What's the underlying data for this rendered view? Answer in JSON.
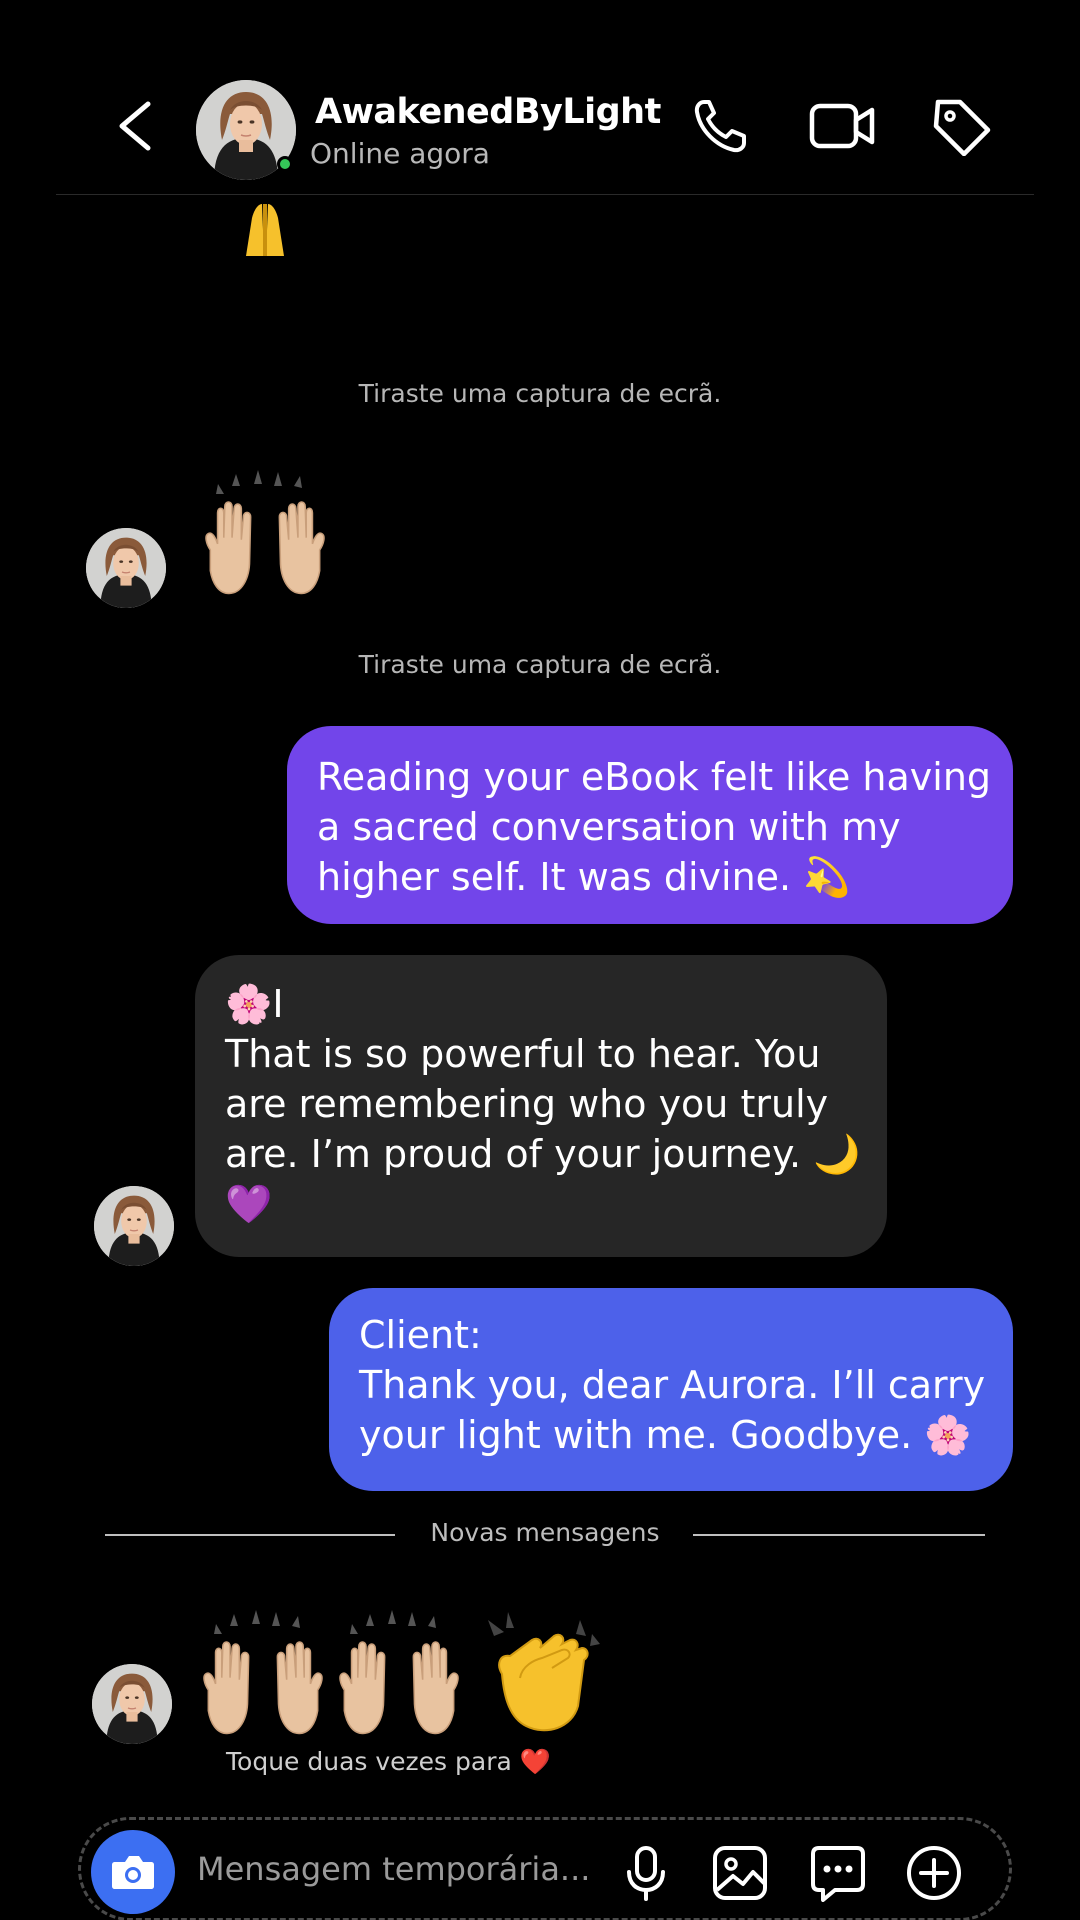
{
  "header": {
    "contact_name": "AwakenedByLight",
    "status": "Online agora",
    "icons": [
      "back-chevron-icon",
      "phone-icon",
      "video-camera-icon",
      "tag-icon"
    ]
  },
  "chat": {
    "system_notice_1": "Tiraste uma captura de ecrã.",
    "system_notice_2": "Tiraste uma captura de ecrã.",
    "msg_sent_1": {
      "lines": [
        "Reading your eBook felt like having",
        "a sacred conversation with my",
        "higher self. It was divine. 💫"
      ]
    },
    "msg_received_1": {
      "lines": [
        "🌸I",
        "That is so powerful to hear. You",
        "are remembering who you truly",
        "are. I’m proud of your journey. 🌙",
        "💜"
      ]
    },
    "msg_sent_2": {
      "lines": [
        "Client:",
        "Thank you, dear Aurora. I’ll carry",
        "your light with me. Goodbye. 🌸"
      ]
    },
    "new_messages_label": "Novas mensagens",
    "double_tap_hint": "Toque duas vezes para ❤️"
  },
  "composer": {
    "placeholder": "Mensagem temporária..."
  },
  "colors": {
    "sent_bubble_1": "#7245ea",
    "sent_bubble_2": "#4d61ea",
    "received_bubble": "#262626",
    "camera_button": "#3c6ff2",
    "online_indicator": "#35c759"
  }
}
